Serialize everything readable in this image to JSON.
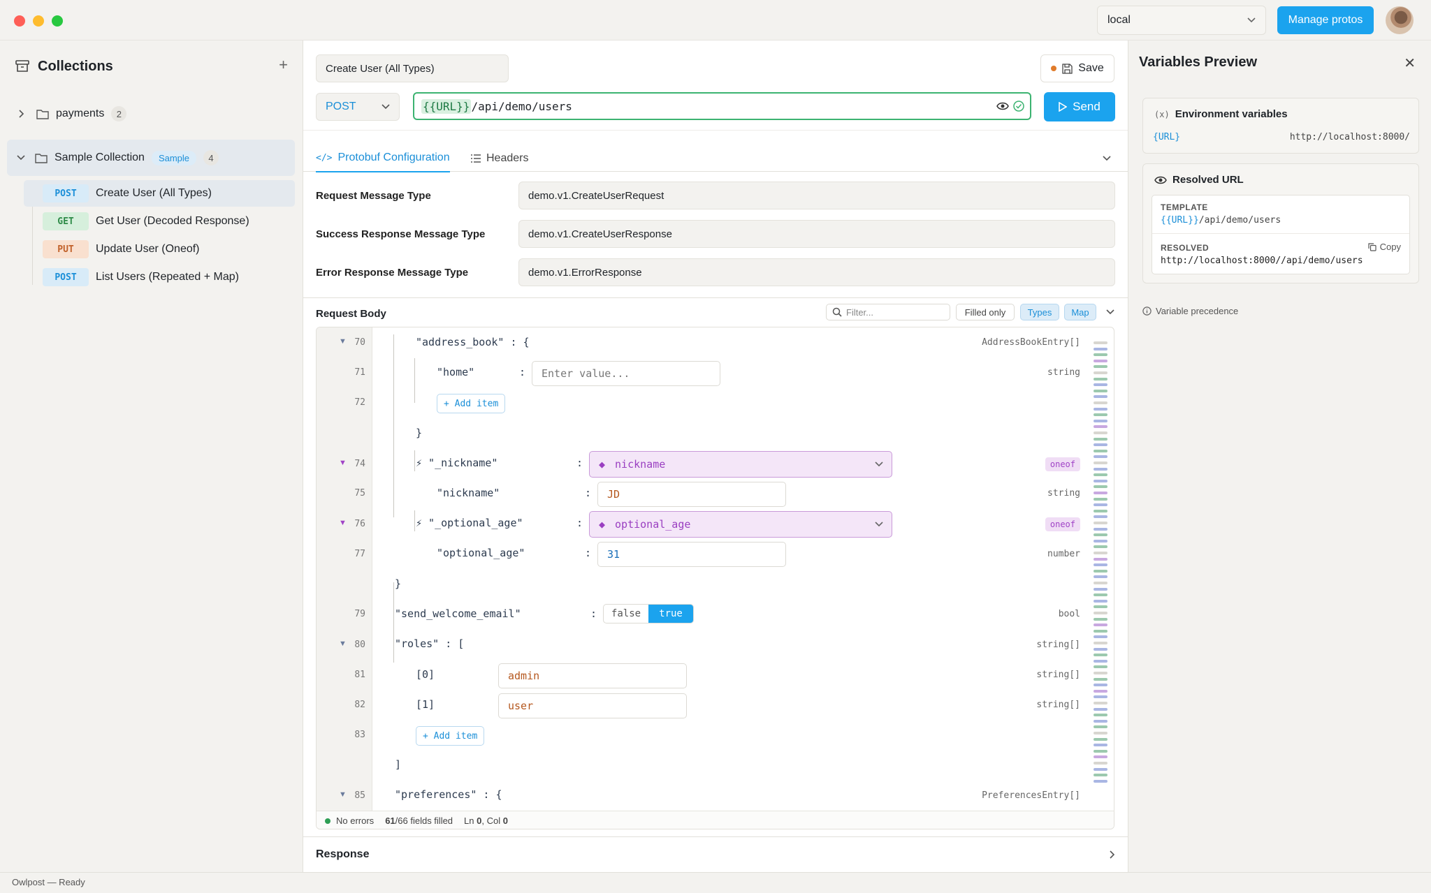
{
  "titlebar": {
    "env_value": "local",
    "manage_label": "Manage protos"
  },
  "sidebar": {
    "title": "Collections",
    "folders": [
      {
        "name": "payments",
        "count": "2"
      },
      {
        "name": "Sample Collection",
        "badge": "Sample",
        "count": "4"
      }
    ],
    "requests": [
      {
        "method": "POST",
        "name": "Create User (All Types)"
      },
      {
        "method": "GET",
        "name": "Get User (Decoded Response)"
      },
      {
        "method": "PUT",
        "name": "Update User (Oneof)"
      },
      {
        "method": "POST",
        "name": "List Users (Repeated + Map)"
      }
    ]
  },
  "request": {
    "name": "Create User (All Types)",
    "save_label": "Save",
    "method": "POST",
    "url_var": "{{URL}}",
    "url_path": "/api/demo/users",
    "send_label": "Send"
  },
  "tabs": {
    "protobuf": "Protobuf Configuration",
    "headers": "Headers"
  },
  "config": {
    "req_label": "Request Message Type",
    "req_value": "demo.v1.CreateUserRequest",
    "succ_label": "Success Response Message Type",
    "succ_value": "demo.v1.CreateUserResponse",
    "err_label": "Error Response Message Type",
    "err_value": "demo.v1.ErrorResponse"
  },
  "body": {
    "title": "Request Body",
    "filter_placeholder": "Filter...",
    "filled_only": "Filled only",
    "types": "Types",
    "map": "Map"
  },
  "editor": {
    "lines": {
      "l70": "70",
      "l71": "71",
      "l72": "72",
      "l74": "74",
      "l75": "75",
      "l76": "76",
      "l77": "77",
      "l79": "79",
      "l80": "80",
      "l81": "81",
      "l82": "82",
      "l83": "83",
      "l85": "85"
    },
    "address_book": "\"address_book\" : {",
    "address_book_type": "AddressBookEntry[]",
    "home_key": "\"home\"",
    "colon": ":",
    "home_placeholder": "Enter value...",
    "string": "string",
    "add_item": "+ Add item",
    "close_brace": "}",
    "nickname_oneof": "⚡ \"_nickname\"",
    "nickname_sel": "nickname",
    "oneof": "oneof",
    "nickname_key": "\"nickname\"",
    "nickname_val": "JD",
    "age_oneof": "⚡ \"_optional_age\"",
    "age_sel": "optional_age",
    "age_key": "\"optional_age\"",
    "age_val": "31",
    "number": "number",
    "welcome_key": "\"send_welcome_email\"",
    "false_label": "false",
    "true_label": "true",
    "bool": "bool",
    "roles": "\"roles\" : [",
    "string_arr": "string[]",
    "idx0": "[0]",
    "idx1": "[1]",
    "role0": "admin",
    "role1": "user",
    "close_bracket": "]",
    "preferences": "\"preferences\" : {",
    "preferences_type": "PreferencesEntry[]"
  },
  "editor_status": {
    "errors": "No errors",
    "filled": "61",
    "filled_total": "/66 fields filled",
    "ln_label": "Ln",
    "ln": "0",
    "col_label": ", Col",
    "col": "0"
  },
  "response": {
    "title": "Response"
  },
  "vars": {
    "title": "Variables Preview",
    "env_title": "Environment variables",
    "var_name": "{URL}",
    "var_value": "http://localhost:8000/",
    "resolved_title": "Resolved URL",
    "template_label": "TEMPLATE",
    "template_var": "{{URL}}",
    "template_path": "/api/demo/users",
    "resolved_label": "RESOLVED",
    "copy_label": "Copy",
    "resolved_value": "http://localhost:8000//api/demo/users",
    "precedence": "Variable precedence"
  },
  "status": {
    "text": "Owlpost — Ready"
  },
  "colors": {
    "accent": "#1ba3ee",
    "variable": "#3cb371",
    "oneof": "#a043c6"
  }
}
